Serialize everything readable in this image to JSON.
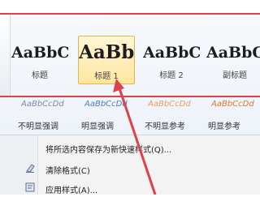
{
  "gallery": {
    "tiles": [
      {
        "sample": "AaBbC",
        "label": "标题"
      },
      {
        "sample": "AaBb",
        "label": "标题 1"
      },
      {
        "sample": "AaBbC",
        "label": "标题 2"
      },
      {
        "sample": "AaBbC",
        "label": "副标题"
      }
    ],
    "row2": [
      {
        "sample": "AaBbCcDd",
        "label": "不明显强调",
        "color": "#7f8aa0"
      },
      {
        "sample": "AaBbCcDd",
        "label": "明显强调",
        "color": "#4f81bd"
      },
      {
        "sample": "AaBbCcDd",
        "label": "不明显参考",
        "color": "#e7a05a"
      },
      {
        "sample": "AaBbCcDd",
        "label": "明显参考",
        "color": "#d97b2b"
      }
    ]
  },
  "menu": {
    "items": [
      {
        "text": "将所选内容保存为新快速样式(Q)...",
        "icon": "save-style-icon"
      },
      {
        "text": "清除格式(C)",
        "icon": "clear-format-icon"
      },
      {
        "text": "应用样式(A)...",
        "icon": "apply-style-icon"
      }
    ]
  },
  "colors": {
    "highlight": "#e0404a",
    "selected": "#ffe6a1",
    "accent": "#4f81bd"
  }
}
